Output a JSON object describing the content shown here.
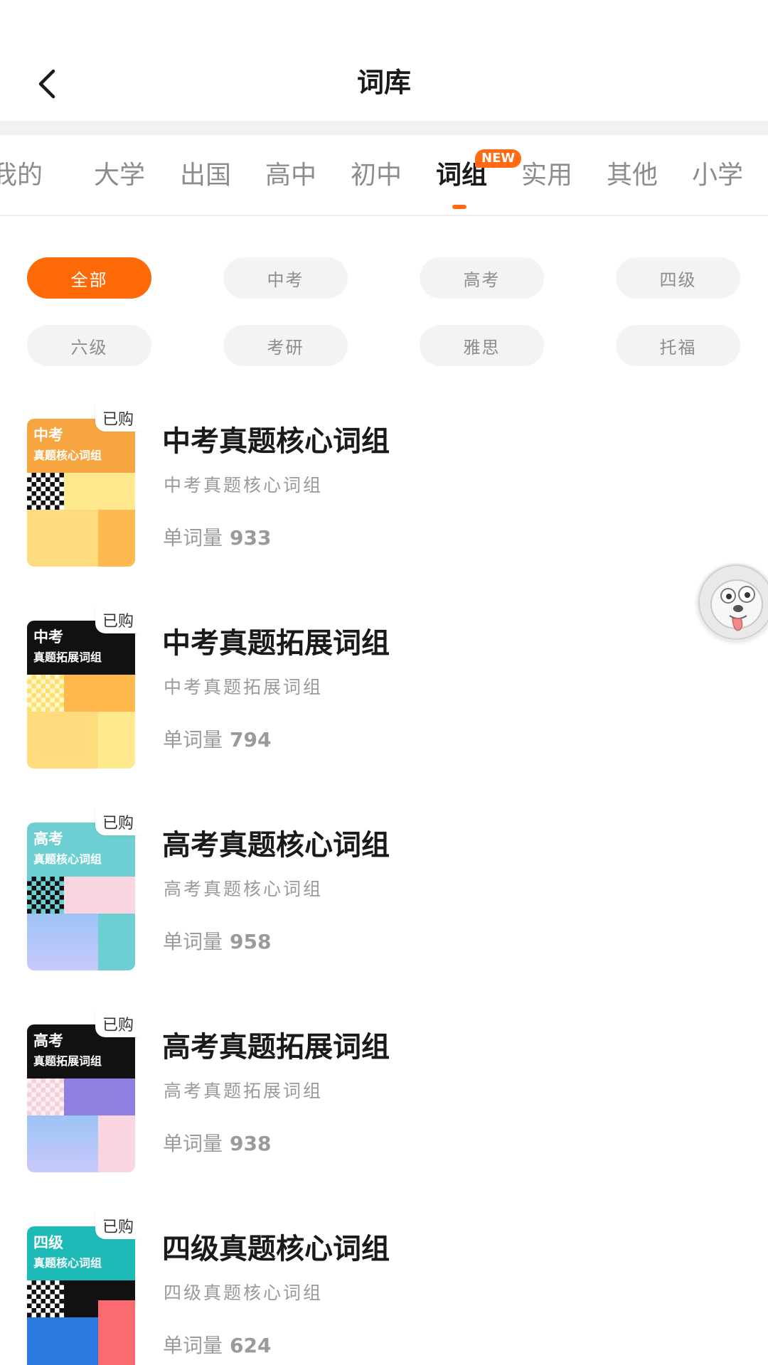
{
  "header": {
    "title": "词库"
  },
  "tabs": {
    "items": [
      "我的",
      "大学",
      "出国",
      "高中",
      "初中",
      "词组",
      "实用",
      "其他",
      "小学"
    ],
    "active_index": 5,
    "new_badge": "NEW"
  },
  "filters": {
    "chips": [
      "全部",
      "中考",
      "高考",
      "四级",
      "六级",
      "考研",
      "雅思",
      "托福"
    ],
    "active_index": 0
  },
  "books": [
    {
      "cover_label": "中考",
      "cover_subtitle": "真题核心词组",
      "owned_label": "已购",
      "title": "中考真题核心词组",
      "subtitle": "中考真题核心词组",
      "count_label": "单词量",
      "count": "933"
    },
    {
      "cover_label": "中考",
      "cover_subtitle": "真题拓展词组",
      "owned_label": "已购",
      "title": "中考真题拓展词组",
      "subtitle": "中考真题拓展词组",
      "count_label": "单词量",
      "count": "794"
    },
    {
      "cover_label": "高考",
      "cover_subtitle": "真题核心词组",
      "owned_label": "已购",
      "title": "高考真题核心词组",
      "subtitle": "高考真题核心词组",
      "count_label": "单词量",
      "count": "958"
    },
    {
      "cover_label": "高考",
      "cover_subtitle": "真题拓展词组",
      "owned_label": "已购",
      "title": "高考真题拓展词组",
      "subtitle": "高考真题拓展词组",
      "count_label": "单词量",
      "count": "938"
    },
    {
      "cover_label": "四级",
      "cover_subtitle": "真题核心词组",
      "owned_label": "已购",
      "title": "四级真题核心词组",
      "subtitle": "四级真题核心词组",
      "count_label": "单词量",
      "count": "624"
    }
  ],
  "colors": {
    "accent": "#ff6a13",
    "chip_bg": "#f3f3f3",
    "text_primary": "#1a1a1a",
    "text_secondary": "#9a9a9a"
  },
  "icons": {
    "back": "chevron-left-icon",
    "mascot": "mascot-dog-icon"
  }
}
